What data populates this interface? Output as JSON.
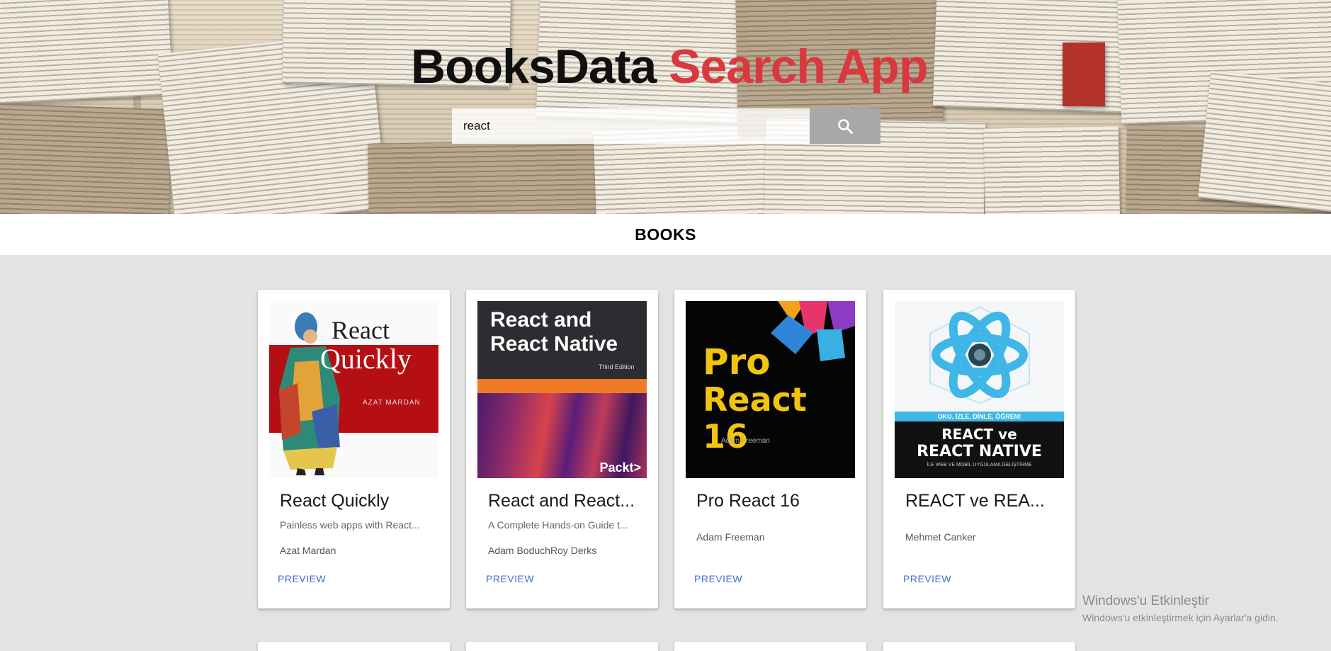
{
  "header": {
    "title_part1": "BooksData",
    "title_part2": "Search App",
    "search": {
      "value": "react",
      "button_icon": "search-icon"
    }
  },
  "section": {
    "heading": "BOOKS"
  },
  "books": [
    {
      "title": "React Quickly",
      "subtitle": "Painless web apps with React...",
      "author": "Azat Mardan",
      "link": "PREVIEW",
      "cover": {
        "line1": "React",
        "line2": "Quickly",
        "author": "AZAT MARDAN"
      }
    },
    {
      "title": "React and React...",
      "subtitle": "A Complete Hands-on Guide t...",
      "author": "Adam BoduchRoy Derks",
      "link": "PREVIEW",
      "cover": {
        "line1": "React and",
        "line2": "React Native",
        "edition": "Third Edition",
        "publisher": "Packt>"
      }
    },
    {
      "title": "Pro React 16",
      "subtitle": "",
      "author": "Adam Freeman",
      "link": "PREVIEW",
      "cover": {
        "line1": "Pro",
        "line2": "React 16",
        "author": "Adam Freeman"
      }
    },
    {
      "title": "REACT ve REA...",
      "subtitle": "",
      "author": "Mehmet Canker",
      "link": "PREVIEW",
      "cover": {
        "tagline": "OKU, İZLE, DİNLE, ÖĞREN!",
        "line1": "REACT ve",
        "line2": "REACT NATIVE",
        "line3": "İLE WEB VE MOBİL UYGULAMA GELİŞTİRME"
      }
    }
  ],
  "watermark": {
    "line1": "Windows'u Etkinleştir",
    "line2": "Windows'u etkinleştirmek için Ayarlar'a gidin."
  },
  "colors": {
    "title_accent": "#d9383f",
    "link": "#3f6fd0",
    "search_button": "#a8a8a8",
    "background": "#e3e3e3"
  }
}
